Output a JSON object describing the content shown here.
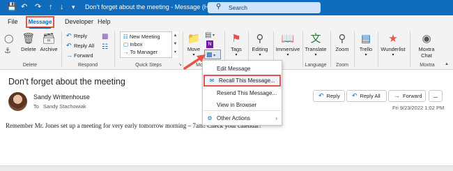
{
  "titlebar": {
    "title": "Don't forget about the meeting  -  Message (HTML)",
    "search_placeholder": "Search",
    "quick_access": [
      "save-icon",
      "undo-icon",
      "redo-icon",
      "up-icon",
      "down-icon",
      "customize-icon"
    ]
  },
  "tabs": [
    "File",
    "Message",
    "Developer",
    "Help"
  ],
  "ribbon": {
    "delete": {
      "delete_label": "Delete",
      "archive_label": "Archive",
      "group_label": "Delete"
    },
    "respond": {
      "reply": "Reply",
      "reply_all": "Reply All",
      "forward": "Forward",
      "group_label": "Respond"
    },
    "quick_steps": {
      "items": [
        "New Meeting",
        "Inbox",
        "To Manager"
      ],
      "group_label": "Quick Steps"
    },
    "move": {
      "move_label": "Move",
      "group_label_partial": "Mo"
    },
    "tags": {
      "label": "Tags"
    },
    "editing": {
      "label": "Editing"
    },
    "immersive": {
      "label": "Immersive"
    },
    "language": {
      "translate_label": "Translate",
      "group_label": "Language"
    },
    "zoom": {
      "label": "Zoom",
      "group_label": "Zoom"
    },
    "trello": {
      "label": "Trello"
    },
    "wunderlist": {
      "label": "Wunderlist"
    },
    "moxtra": {
      "label_line1": "Moxtra",
      "label_line2": "Chat",
      "group_label": "Moxtra"
    }
  },
  "message": {
    "subject": "Don't forget about the meeting",
    "sender": "Sandy Writtenhouse",
    "to_label": "To",
    "to_name": "Sandy Stachowiak",
    "date": "Fri 9/23/2022 1:02 PM",
    "body": "Remember Mr. Jones set up a meeting for very early tomorrow morning – 7am! Check your calendar!",
    "actions": {
      "reply": "Reply",
      "reply_all": "Reply All",
      "forward": "Forward",
      "more": "..."
    }
  },
  "dropdown": {
    "items": [
      {
        "label": "Edit Message",
        "icon": ""
      },
      {
        "label": "Recall This Message...",
        "icon": "recall-icon"
      },
      {
        "label": "Resend This Message...",
        "icon": ""
      },
      {
        "label": "View in Browser",
        "icon": ""
      },
      {
        "label": "Other Actions",
        "icon": "other-actions-icon"
      }
    ]
  },
  "colors": {
    "titlebar": "#0f6cbd",
    "accent": "#0f6cbd",
    "highlight": "#e5534b",
    "ribbon_bg": "#f3f3f3"
  }
}
